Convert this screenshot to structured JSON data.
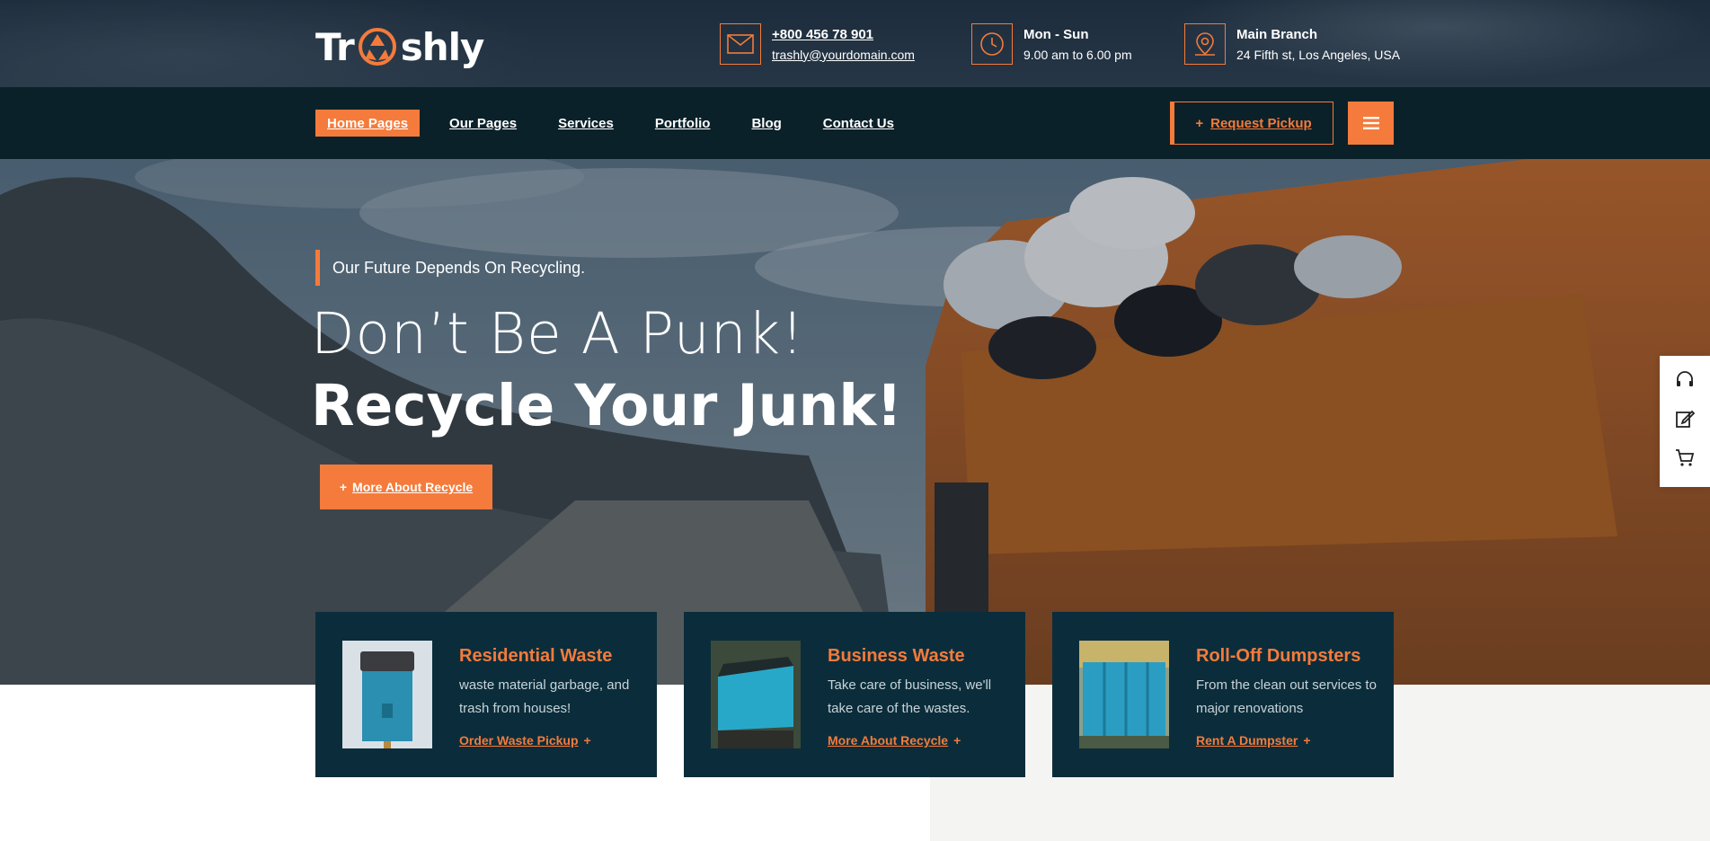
{
  "brand": {
    "logo_left": "Tr",
    "logo_right": "shly"
  },
  "contacts": [
    {
      "icon": "envelope-icon",
      "line1": "+800 456 78 901",
      "line2": "trashly@yourdomain.com"
    },
    {
      "icon": "clock-icon",
      "line1": "Mon - Sun",
      "line2": "9.00 am to 6.00 pm"
    },
    {
      "icon": "map-pin-icon",
      "line1": "Main Branch",
      "line2": "24 Fifth st, Los Angeles, USA"
    }
  ],
  "nav": {
    "items": [
      {
        "label": "Home Pages",
        "active": true
      },
      {
        "label": "Our Pages"
      },
      {
        "label": "Services"
      },
      {
        "label": "Portfolio"
      },
      {
        "label": "Blog"
      },
      {
        "label": "Contact Us"
      }
    ],
    "pickup_label": "Request Pickup"
  },
  "hero": {
    "tagline": "Our Future Depends On Recycling.",
    "title_line1": "Don’t Be A Punk!",
    "title_line2": "Recycle Your Junk!",
    "button_label": "More About Recycle"
  },
  "cards": [
    {
      "title": "Residential Waste",
      "desc": "waste material garbage, and trash from houses!",
      "link": "Order Waste Pickup"
    },
    {
      "title": "Business Waste",
      "desc": "Take care of business, we'll take care of the wastes.",
      "link": "More About Recycle"
    },
    {
      "title": "Roll-Off Dumpsters",
      "desc": "From the clean out services to major renovations",
      "link": "Rent A Dumpster"
    }
  ],
  "side_icons": [
    "headset-icon",
    "edit-icon",
    "cart-icon"
  ],
  "colors": {
    "accent": "#f47b3b",
    "navy": "#0b2129",
    "card": "#0b2d3b"
  }
}
